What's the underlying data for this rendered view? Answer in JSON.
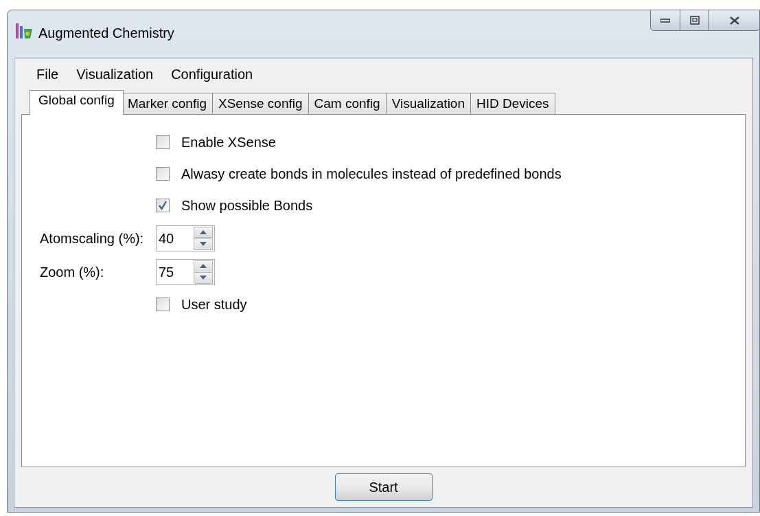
{
  "window": {
    "title": "Augmented Chemistry"
  },
  "menu": [
    "File",
    "Visualization",
    "Configuration"
  ],
  "tabs": [
    {
      "label": "Global config",
      "selected": true
    },
    {
      "label": "Marker config",
      "selected": false
    },
    {
      "label": "XSense config",
      "selected": false
    },
    {
      "label": "Cam config",
      "selected": false
    },
    {
      "label": "Visualization",
      "selected": false
    },
    {
      "label": "HID Devices",
      "selected": false
    }
  ],
  "rows": [
    {
      "kind": "checkbox",
      "label": "Enable XSense",
      "checked": false
    },
    {
      "kind": "checkbox",
      "label": "Alwasy create bonds in molecules instead of predefined bonds",
      "checked": false
    },
    {
      "kind": "checkbox",
      "label": "Show possible Bonds",
      "checked": true
    },
    {
      "kind": "spinner",
      "label": "Atomscaling (%):",
      "value": "40"
    },
    {
      "kind": "spinner",
      "label": "Zoom (%):",
      "value": "75"
    },
    {
      "kind": "checkbox",
      "label": "User study",
      "checked": false
    }
  ],
  "button": "Start"
}
